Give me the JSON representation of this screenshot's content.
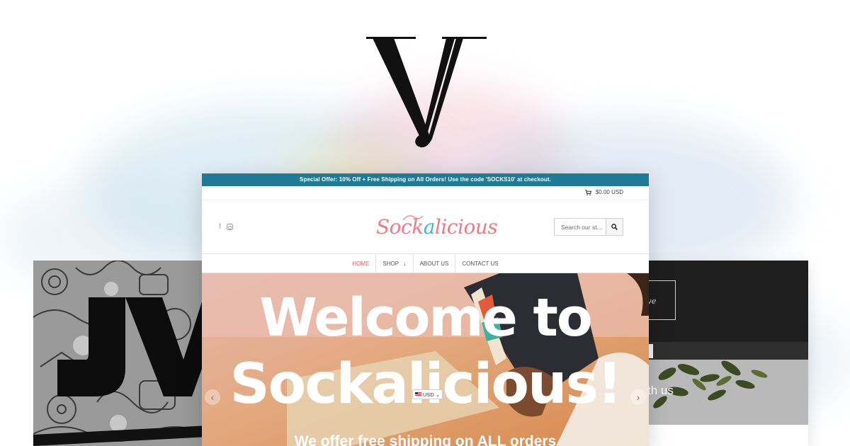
{
  "store": {
    "announcement": {
      "prefix": "Special Offer: 10% Off + Free Shipping on All Orders! Use the code '",
      "code": "SOCKS10",
      "suffix": "' at checkout."
    },
    "cart": {
      "total": "$0.00 USD",
      "icon": "cart-icon"
    },
    "social": {
      "facebook_glyph": "f",
      "icons": [
        "facebook-icon",
        "instagram-icon"
      ]
    },
    "logo": {
      "part1": "Sock",
      "part2": "a",
      "part3": "licious"
    },
    "search": {
      "placeholder": "Search our st...",
      "icon": "search-icon"
    },
    "nav": [
      {
        "label": "HOME",
        "active": true
      },
      {
        "label": "SHOP",
        "has_dropdown": true
      },
      {
        "label": "ABOUT US"
      },
      {
        "label": "CONTACT US"
      }
    ],
    "hero": {
      "line1": "Welcome to",
      "line2": "Sockalicious!",
      "subtitle": "We offer free shipping on ALL orders",
      "prev_arrow": "‹",
      "next_arrow": "›"
    },
    "currency_selector": {
      "value": "USD",
      "caret": "⌄"
    }
  },
  "right_card": {
    "frame_text": "hive",
    "hero_text": "th us"
  },
  "colors": {
    "announcement_bg": "#1f7a96",
    "logo_pink": "#f07a84",
    "logo_blue": "#3ab8d8",
    "nav_active": "#ef5a5a"
  }
}
